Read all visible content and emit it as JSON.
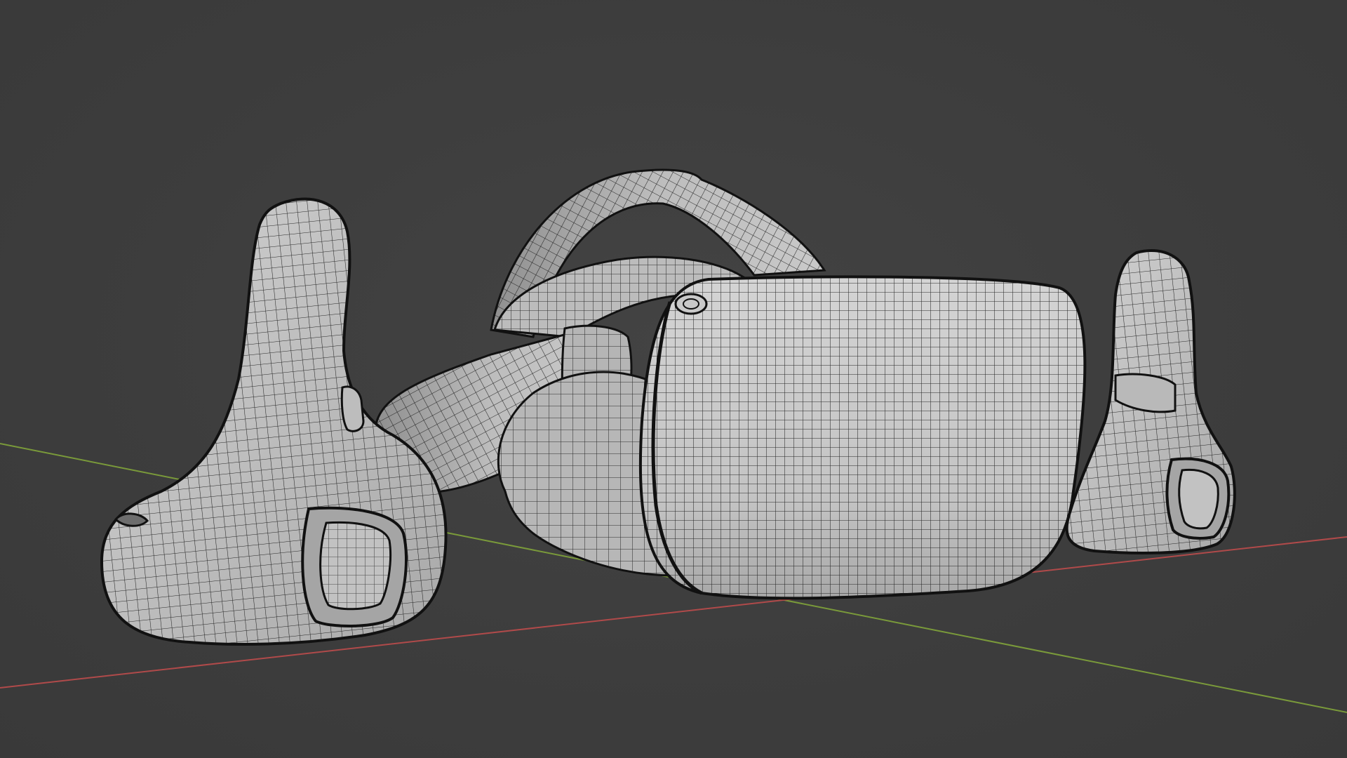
{
  "viewport": {
    "background_color": "#3d3d3d",
    "mesh_fill_color": "#c7c7c7",
    "mesh_shadow_color": "#9a9a9a",
    "wire_color": "#141414",
    "x_axis_color": "#b04a4a",
    "y_axis_color": "#7a9a3a",
    "shading_mode": "solid-wireframe",
    "objects": [
      {
        "name": "left-controller",
        "kind": "vr-controller"
      },
      {
        "name": "vr-headset",
        "kind": "headset"
      },
      {
        "name": "right-controller",
        "kind": "vr-controller"
      }
    ]
  }
}
